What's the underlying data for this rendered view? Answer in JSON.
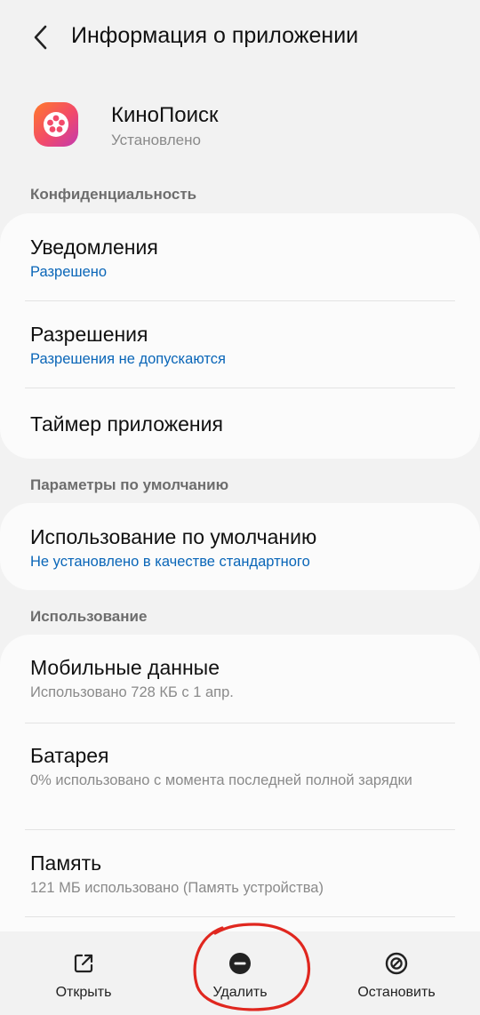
{
  "header": {
    "title": "Информация о приложении"
  },
  "app": {
    "name": "КиноПоиск",
    "status": "Установлено"
  },
  "privacy": {
    "section_title": "Конфиденциальность",
    "items": [
      {
        "title": "Уведомления",
        "subtitle": "Разрешено"
      },
      {
        "title": "Разрешения",
        "subtitle": "Разрешения не допускаются"
      },
      {
        "title": "Таймер приложения"
      }
    ]
  },
  "defaults": {
    "section_title": "Параметры по умолчанию",
    "items": [
      {
        "title": "Использование по умолчанию",
        "subtitle": "Не установлено в качестве стандартного"
      }
    ]
  },
  "usage": {
    "section_title": "Использование",
    "items": [
      {
        "title": "Мобильные данные",
        "subtitle": "Использовано 728 КБ с 1 апр."
      },
      {
        "title": "Батарея",
        "subtitle": "0% использовано с момента последней полной зарядки"
      },
      {
        "title": "Память",
        "subtitle": "121 МБ использовано (Память устройства)"
      }
    ]
  },
  "bottom_bar": {
    "open_label": "Открыть",
    "delete_label": "Удалить",
    "stop_label": "Остановить"
  },
  "colors": {
    "link_blue": "#0a66b8",
    "annotation_red": "#e0271f",
    "icon_gradient": [
      "#ff7a2a",
      "#f24a6a",
      "#c23ab0"
    ]
  },
  "icons": [
    "back-arrow-icon",
    "kinopoisk-app-icon",
    "open-external-icon",
    "minus-circle-icon",
    "stop-circle-icon"
  ]
}
